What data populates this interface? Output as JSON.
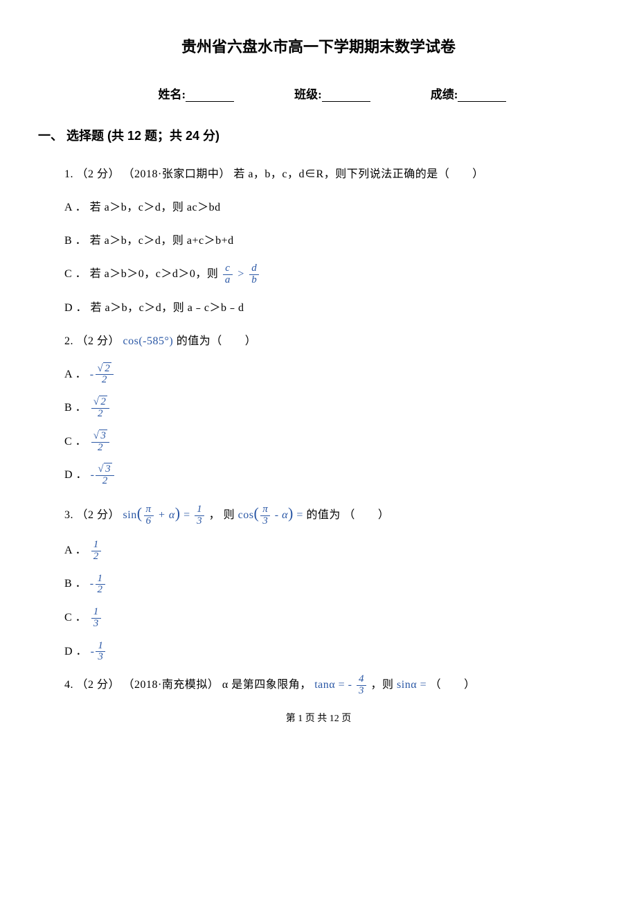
{
  "title": "贵州省六盘水市高一下学期期末数学试卷",
  "header": {
    "name_label": "姓名:",
    "class_label": "班级:",
    "score_label": "成绩:"
  },
  "section1": {
    "title": "一、 选择题 (共 12 题；共 24 分)"
  },
  "q1": {
    "stem_prefix": "1. （2 分） （2018·张家口期中） 若 a，b，c，d∈R，则下列说法正确的是（　　）",
    "A": "A ． 若 a＞b，c＞d，则 ac＞bd",
    "B": "B ． 若 a＞b，c＞d，则 a+c＞b+d",
    "C_text1": "C ． 若 a＞b＞0，c＞d＞0，则 ",
    "C_frac_l_num": "c",
    "C_frac_l_den": "a",
    "C_gt": " > ",
    "C_frac_r_num": "d",
    "C_frac_r_den": "b",
    "D": "D ． 若 a＞b，c＞d，则 a﹣c＞b﹣d"
  },
  "q2": {
    "stem_prefix": "2. （2 分） ",
    "stem_math": "cos(‑585°)",
    "stem_suffix": " 的值为（　　）",
    "A_prefix": "A ． ",
    "A_sign": "‑",
    "B_prefix": "B ． ",
    "C_prefix": "C ． ",
    "D_prefix": "D ． ",
    "D_sign": "‑",
    "root2": "2",
    "root3": "3",
    "den2": "2"
  },
  "q3": {
    "stem_prefix": "3. （2 分） ",
    "m1a": "sin",
    "m1b": "π",
    "m1c": "6",
    "m1d": "+ α",
    "m1e": " = ",
    "m1f_num": "1",
    "m1f_den": "3",
    "mid": " ，  则",
    "m2a": "cos",
    "m2b": "π",
    "m2c": "3",
    "m2d": "‑ α",
    "m2e": " = ",
    "stem_suffix": " 的值为    （　　）",
    "A_prefix": "A ． ",
    "A_num": "1",
    "A_den": "2",
    "B_prefix": "B ． ",
    "B_sign": "‑",
    "B_num": "1",
    "B_den": "2",
    "C_prefix": "C ． ",
    "C_num": "1",
    "C_den": "3",
    "D_prefix": "D ． ",
    "D_sign": "‑",
    "D_num": "1",
    "D_den": "3"
  },
  "q4": {
    "stem_prefix": "4. （2 分） （2018·南充模拟） α 是第四象限角， ",
    "m1": "tanα = ‑ ",
    "m1_num": "4",
    "m1_den": "3",
    "mid": " ，则 ",
    "m2": "sinα = ",
    "stem_suffix": "  （　　）"
  },
  "footer": {
    "text": "第 1 页 共 12 页"
  }
}
